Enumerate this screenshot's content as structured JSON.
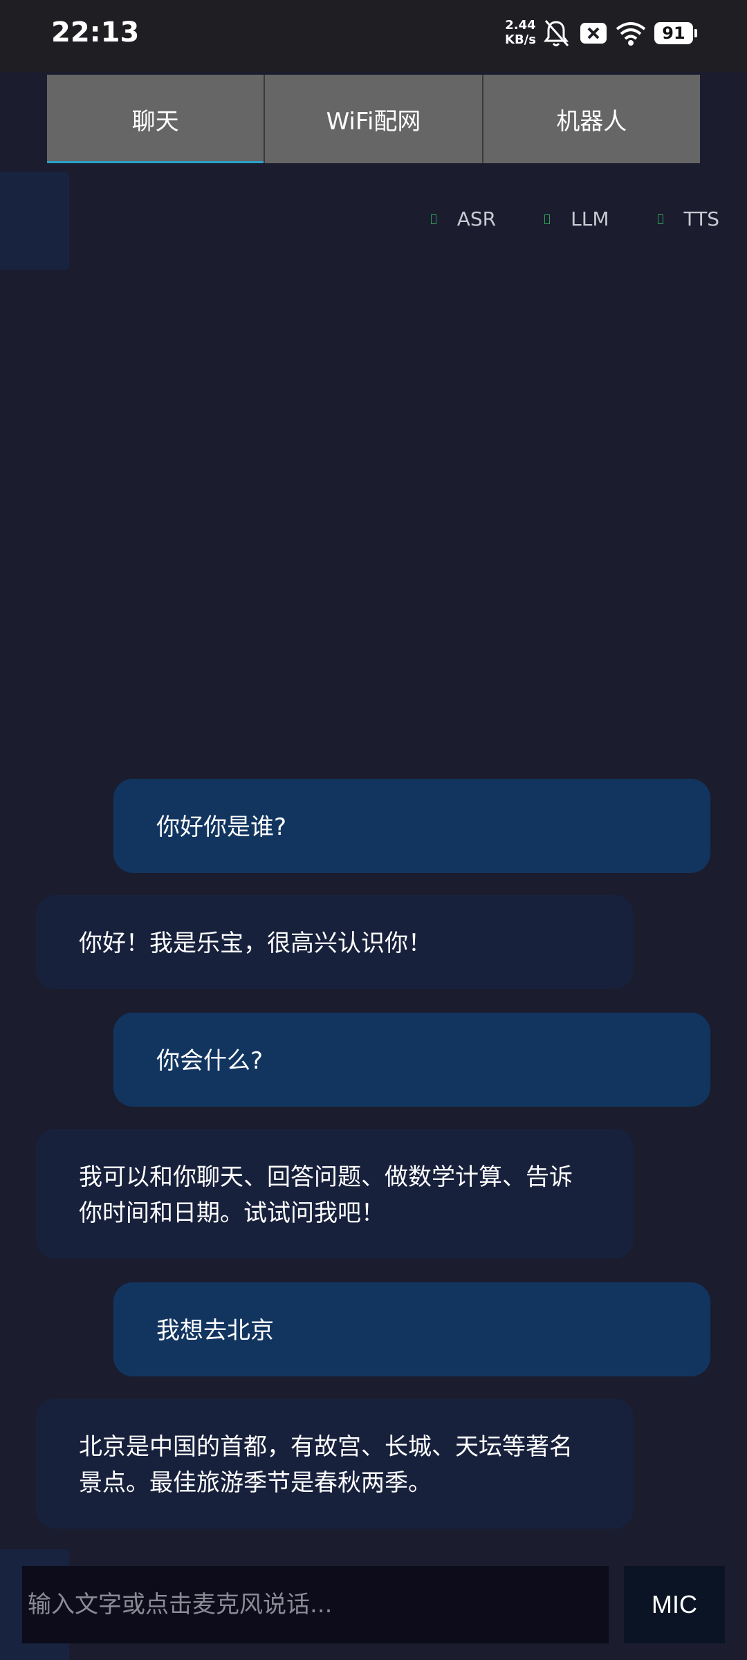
{
  "status_bar": {
    "time": "22:13",
    "net_speed_value": "2.44",
    "net_speed_unit": "KB/s",
    "battery": "91"
  },
  "tabs": [
    {
      "label": "聊天",
      "active": true
    },
    {
      "label": "WiFi配网",
      "active": false
    },
    {
      "label": "机器人",
      "active": false
    }
  ],
  "indicators": [
    {
      "label": "ASR",
      "color": "#2e9e59"
    },
    {
      "label": "LLM",
      "color": "#2e9e59"
    },
    {
      "label": "TTS",
      "color": "#2e9e59"
    }
  ],
  "messages": [
    {
      "role": "user",
      "text": "你好你是谁?"
    },
    {
      "role": "bot",
      "text": "你好！我是乐宝，很高兴认识你！"
    },
    {
      "role": "user",
      "text": "你会什么?"
    },
    {
      "role": "bot",
      "text": "我可以和你聊天、回答问题、做数学计算、告诉你时间和日期。试试问我吧！"
    },
    {
      "role": "user",
      "text": "我想去北京"
    },
    {
      "role": "bot",
      "text": "北京是中国的首都，有故宫、长城、天坛等著名景点。最佳旅游季节是春秋两季。"
    }
  ],
  "input": {
    "placeholder": "输入文字或点击麦克风说话...",
    "value": ""
  },
  "mic_label": "MIC",
  "colors": {
    "background": "#1b1c2d",
    "user_bubble": "#123560",
    "bot_bubble": "#18213c",
    "tab": "#666666",
    "tab_active_indicator": "#2aa3c9"
  }
}
